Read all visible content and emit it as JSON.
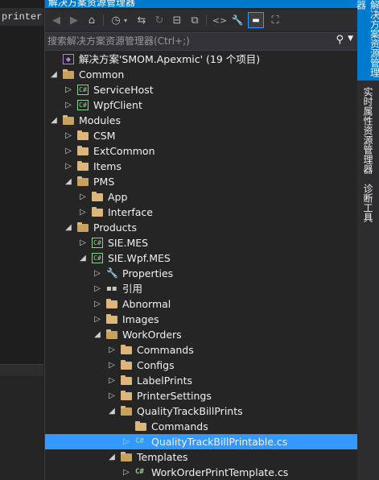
{
  "editor": {
    "code_fragment": "printer, ("
  },
  "panel": {
    "title": "解决方案资源管理器",
    "search_placeholder": "搜索解决方案资源管理器(Ctrl+;)"
  },
  "toolbar": {
    "buttons": [
      {
        "name": "back-icon",
        "glyph": "◀"
      },
      {
        "name": "forward-icon",
        "glyph": "▶"
      },
      {
        "name": "home-icon",
        "glyph": "⌂"
      },
      {
        "name": "pending-changes-icon",
        "glyph": "◷"
      },
      {
        "name": "sync-icon",
        "glyph": "⇆"
      },
      {
        "name": "refresh-icon",
        "glyph": "↻"
      },
      {
        "name": "collapse-all-icon",
        "glyph": "⊟"
      },
      {
        "name": "show-all-files-icon",
        "glyph": "⧉"
      },
      {
        "name": "view-code-icon",
        "glyph": "<>"
      },
      {
        "name": "properties-icon",
        "glyph": "🔧"
      },
      {
        "name": "preview-icon",
        "glyph": "▬"
      },
      {
        "name": "class-view-icon",
        "glyph": "⛶"
      }
    ]
  },
  "tree": [
    {
      "label": "解决方案'SMOM.Apexmic' (19 个项目)",
      "depth": 0,
      "expander": "none",
      "icon": "solution"
    },
    {
      "label": "Common",
      "depth": 0,
      "expander": "expanded",
      "icon": "folder-open"
    },
    {
      "label": "ServiceHost",
      "depth": 1,
      "expander": "collapsed",
      "icon": "csproj"
    },
    {
      "label": "WpfClient",
      "depth": 1,
      "expander": "collapsed",
      "icon": "csproj"
    },
    {
      "label": "Modules",
      "depth": 0,
      "expander": "expanded",
      "icon": "folder-open"
    },
    {
      "label": "CSM",
      "depth": 1,
      "expander": "collapsed",
      "icon": "folder"
    },
    {
      "label": "ExtCommon",
      "depth": 1,
      "expander": "collapsed",
      "icon": "folder"
    },
    {
      "label": "Items",
      "depth": 1,
      "expander": "collapsed",
      "icon": "folder"
    },
    {
      "label": "PMS",
      "depth": 1,
      "expander": "expanded",
      "icon": "folder-open"
    },
    {
      "label": "App",
      "depth": 2,
      "expander": "collapsed",
      "icon": "folder"
    },
    {
      "label": "Interface",
      "depth": 2,
      "expander": "collapsed",
      "icon": "folder"
    },
    {
      "label": "Products",
      "depth": 1,
      "expander": "expanded",
      "icon": "folder-open"
    },
    {
      "label": "SIE.MES",
      "depth": 2,
      "expander": "collapsed",
      "icon": "csproj"
    },
    {
      "label": "SIE.Wpf.MES",
      "depth": 2,
      "expander": "expanded",
      "icon": "csproj"
    },
    {
      "label": "Properties",
      "depth": 3,
      "expander": "collapsed",
      "icon": "wrench"
    },
    {
      "label": "引用",
      "depth": 3,
      "expander": "collapsed",
      "icon": "references"
    },
    {
      "label": "Abnormal",
      "depth": 3,
      "expander": "collapsed",
      "icon": "folder"
    },
    {
      "label": "Images",
      "depth": 3,
      "expander": "collapsed",
      "icon": "folder"
    },
    {
      "label": "WorkOrders",
      "depth": 3,
      "expander": "expanded",
      "icon": "folder-open"
    },
    {
      "label": "Commands",
      "depth": 4,
      "expander": "collapsed",
      "icon": "folder"
    },
    {
      "label": "Configs",
      "depth": 4,
      "expander": "collapsed",
      "icon": "folder"
    },
    {
      "label": "LabelPrints",
      "depth": 4,
      "expander": "collapsed",
      "icon": "folder"
    },
    {
      "label": "PrinterSettings",
      "depth": 4,
      "expander": "collapsed",
      "icon": "folder"
    },
    {
      "label": "QualityTrackBillPrints",
      "depth": 4,
      "expander": "expanded",
      "icon": "folder-open"
    },
    {
      "label": "Commands",
      "depth": 5,
      "expander": "none",
      "icon": "folder"
    },
    {
      "label": "QualityTrackBillPrintable.cs",
      "depth": 5,
      "expander": "collapsed",
      "icon": "csfile",
      "selected": true
    },
    {
      "label": "Templates",
      "depth": 4,
      "expander": "expanded",
      "icon": "folder-open"
    },
    {
      "label": "WorkOrderPrintTemplate.cs",
      "depth": 5,
      "expander": "collapsed",
      "icon": "csfile"
    }
  ],
  "vertical_tabs": [
    {
      "label": "解决方案资源管理器",
      "active": true
    },
    {
      "label": "实时属性资源管理器",
      "active": false
    },
    {
      "label": "诊断工具",
      "active": false
    }
  ],
  "colors": {
    "accent": "#007acc",
    "selection": "#3399ff",
    "folder": "#dcb67a",
    "cs": "#8dd28a"
  }
}
